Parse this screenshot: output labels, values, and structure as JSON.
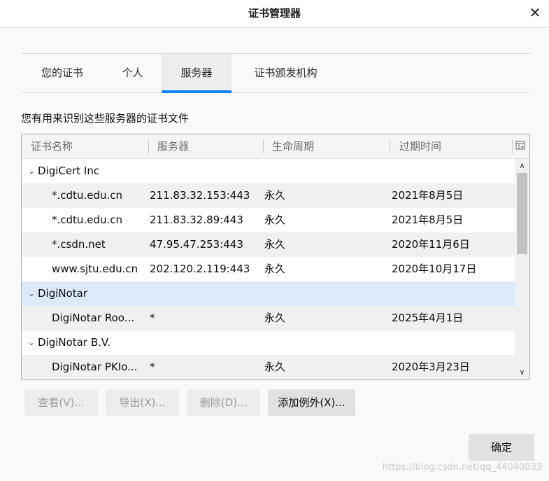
{
  "window": {
    "title": "证书管理器",
    "close_glyph": "✕"
  },
  "tabs": [
    {
      "label": "您的证书"
    },
    {
      "label": "个人"
    },
    {
      "label": "服务器",
      "active": true
    },
    {
      "label": "证书颁发机构"
    }
  ],
  "description": "您有用来识别这些服务器的证书文件",
  "table": {
    "columns": [
      "证书名称",
      "服务器",
      "生命周期",
      "过期时间"
    ],
    "column_picker_icon": "column-picker-icon",
    "groups": [
      {
        "name": "DigiCert Inc",
        "rows": [
          {
            "name": "*.cdtu.edu.cn",
            "server": "211.83.32.153:443",
            "lifetime": "永久",
            "expires": "2021年8月5日"
          },
          {
            "name": "*.cdtu.edu.cn",
            "server": "211.83.32.89:443",
            "lifetime": "永久",
            "expires": "2021年8月5日"
          },
          {
            "name": "*.csdn.net",
            "server": "47.95.47.253:443",
            "lifetime": "永久",
            "expires": "2020年11月6日"
          },
          {
            "name": "www.sjtu.edu.cn",
            "server": "202.120.2.119:443",
            "lifetime": "永久",
            "expires": "2020年10月17日"
          }
        ]
      },
      {
        "name": "DigiNotar",
        "selected": true,
        "rows": [
          {
            "name": "DigiNotar Roo...",
            "server": "*",
            "lifetime": "永久",
            "expires": "2025年4月1日"
          }
        ]
      },
      {
        "name": "DigiNotar B.V.",
        "rows": [
          {
            "name": "DigiNotar PKIo...",
            "server": "*",
            "lifetime": "永久",
            "expires": "2020年3月23日"
          }
        ]
      }
    ]
  },
  "buttons": {
    "view": "查看(V)...",
    "export": "导出(X)...",
    "delete": "删除(D)...",
    "add_exception": "添加例外(X)...",
    "ok": "确定"
  },
  "watermark": "https://blog.csdn.net/qq_44040833",
  "colors": {
    "accent": "#0a84ff",
    "selected_row": "#dbe9f9"
  }
}
